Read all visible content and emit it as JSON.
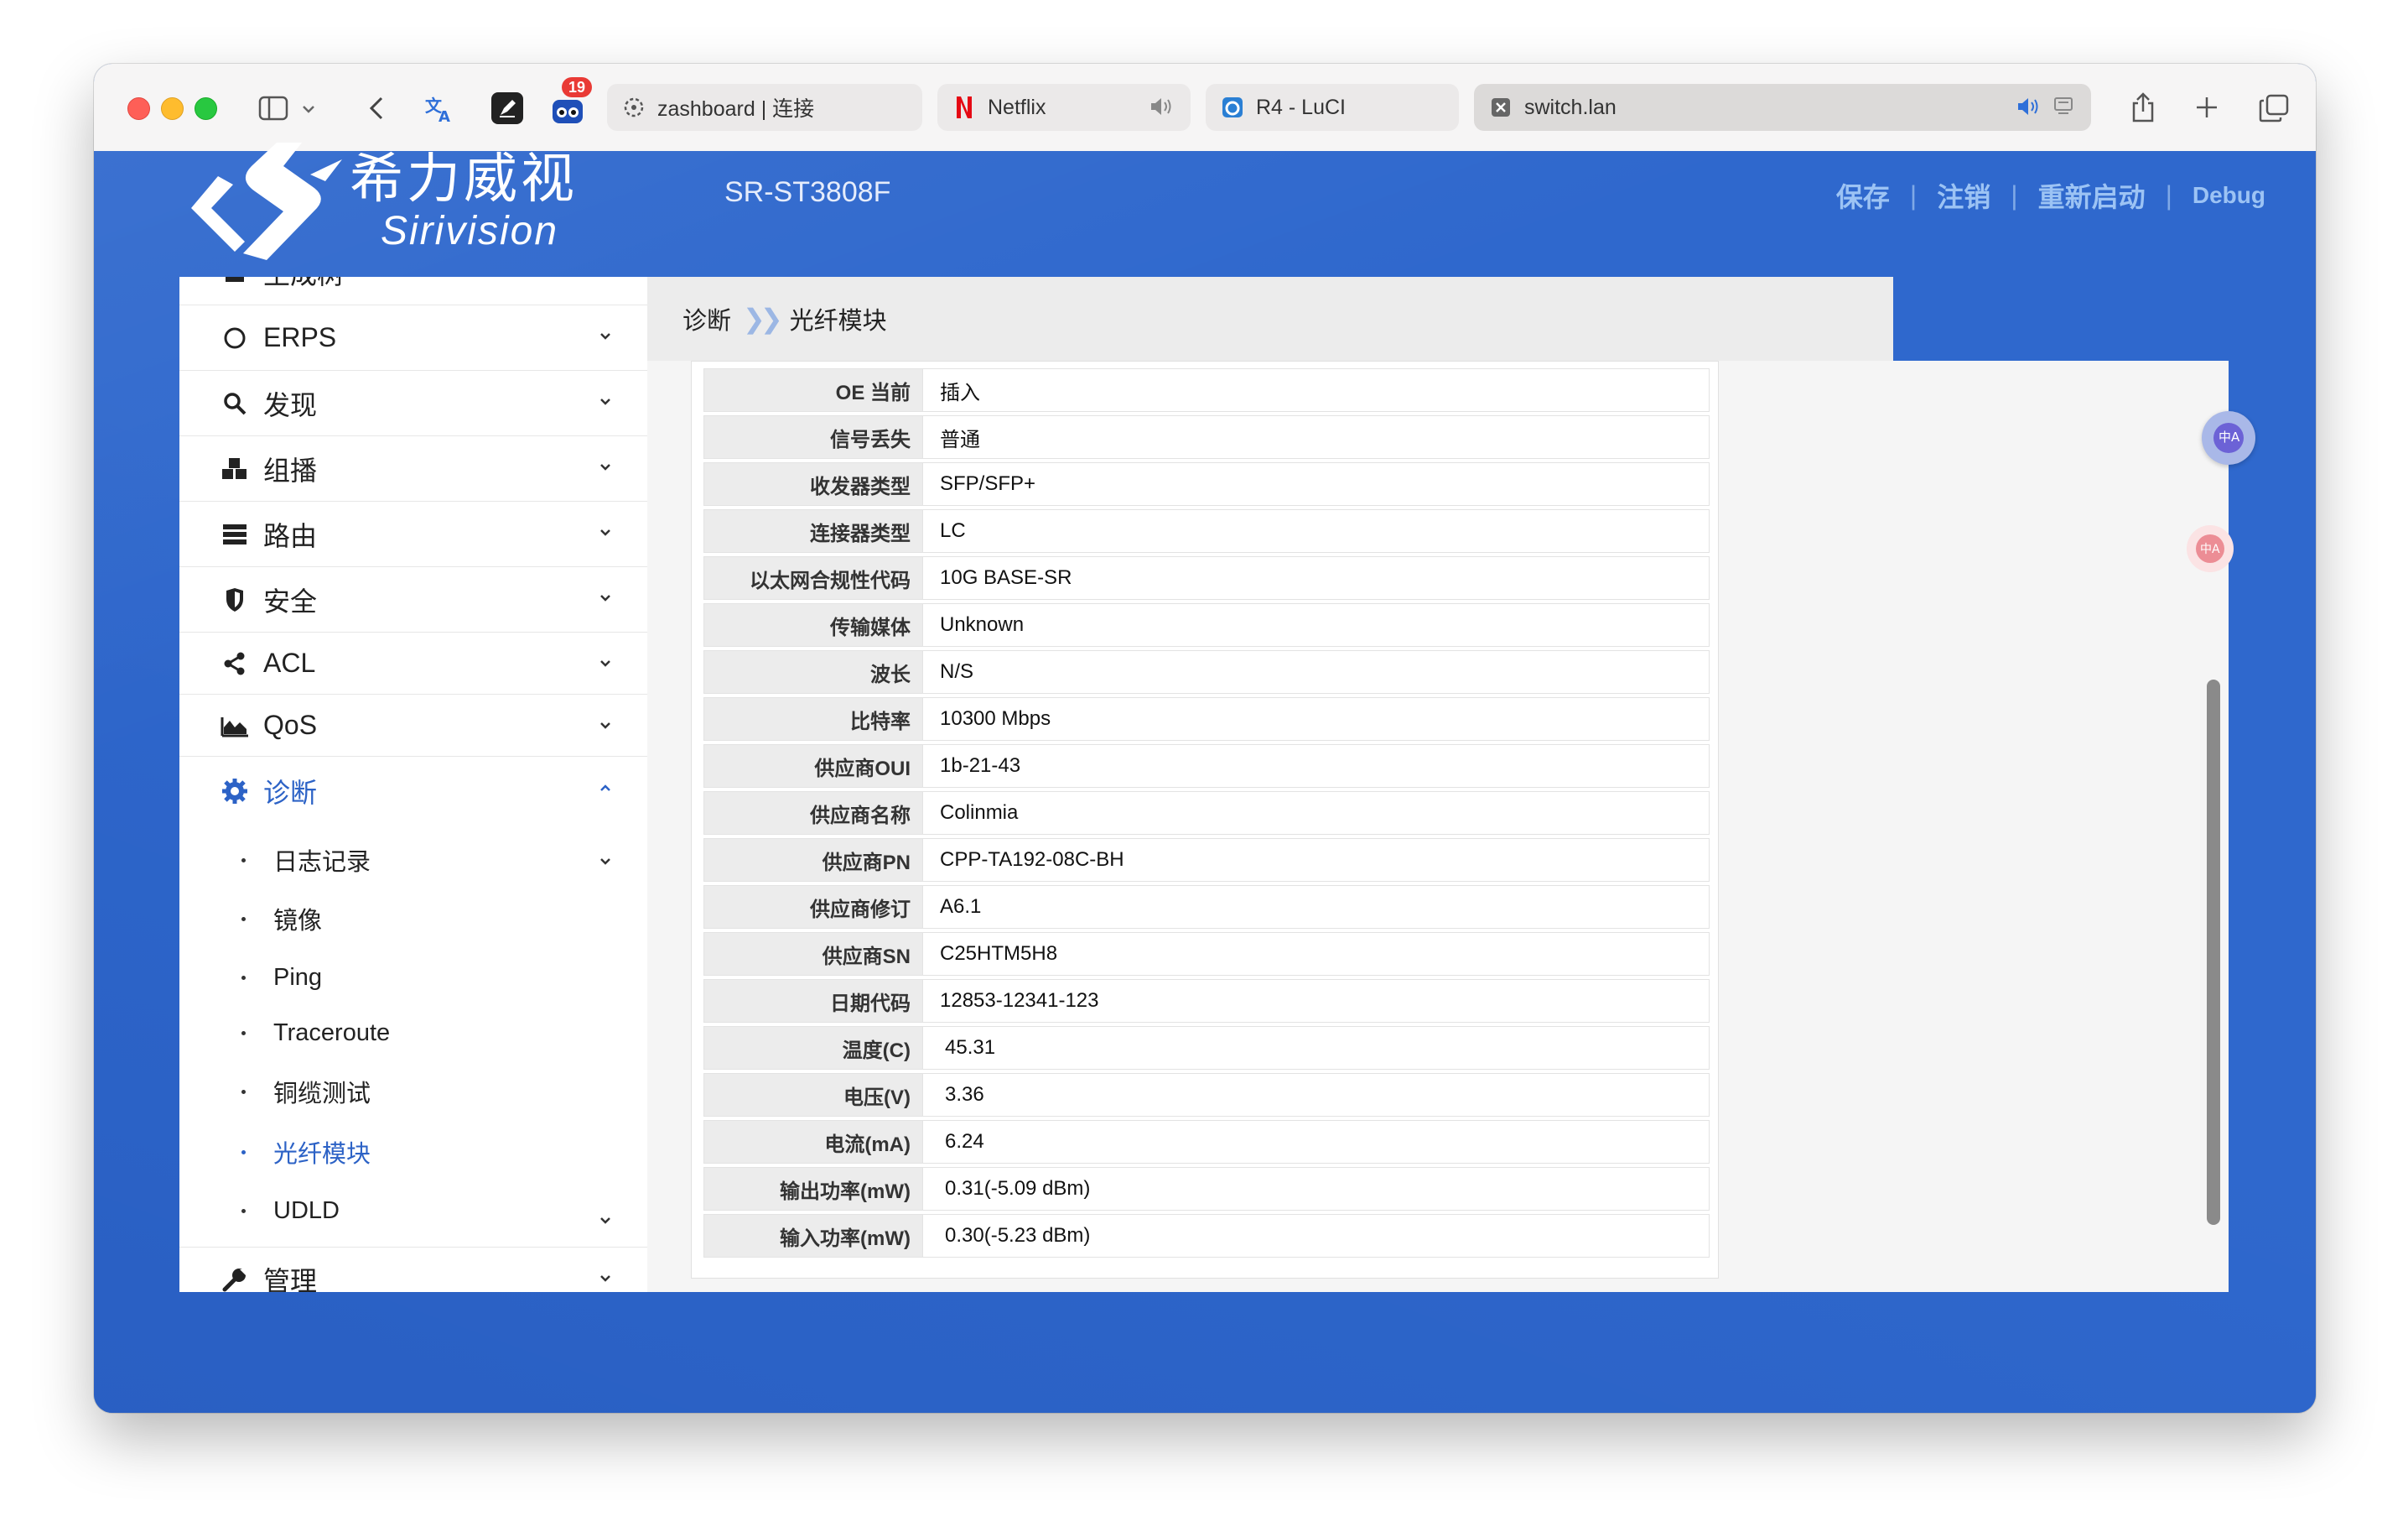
{
  "browser": {
    "tabs": [
      {
        "label": "zashboard | 连接",
        "icon": "zashboard-icon",
        "active": false
      },
      {
        "label": "Netflix",
        "icon": "netflix-icon",
        "active": false
      },
      {
        "label": "R4 - LuCI",
        "icon": "luci-icon",
        "active": false
      },
      {
        "label": "switch.lan",
        "icon": "close-tab-icon",
        "active": true
      }
    ],
    "extension_badge": "19"
  },
  "header": {
    "logo_cn": "希力威视",
    "logo_en": "Sirivision",
    "model": "SR-ST3808F",
    "nav": {
      "save": "保存",
      "logout": "注销",
      "reboot": "重新启动",
      "debug": "Debug"
    }
  },
  "sidebar": {
    "partial_top_label": "生成树",
    "items": [
      {
        "label": "ERPS",
        "icon": "circle-icon"
      },
      {
        "label": "发现",
        "icon": "search-icon"
      },
      {
        "label": "组播",
        "icon": "cubes-icon"
      },
      {
        "label": "路由",
        "icon": "server-icon"
      },
      {
        "label": "安全",
        "icon": "shield-icon"
      },
      {
        "label": "ACL",
        "icon": "share-icon"
      },
      {
        "label": "QoS",
        "icon": "area-chart-icon"
      },
      {
        "label": "诊断",
        "icon": "gear-icon"
      },
      {
        "label": "管理",
        "icon": "wrench-icon"
      }
    ],
    "sub_items": [
      {
        "label": "日志记录"
      },
      {
        "label": "镜像"
      },
      {
        "label": "Ping"
      },
      {
        "label": "Traceroute"
      },
      {
        "label": "铜缆测试"
      },
      {
        "label": "光纤模块"
      },
      {
        "label": "UDLD"
      }
    ]
  },
  "breadcrumb": {
    "parent": "诊断",
    "current": "光纤模块"
  },
  "module_info": [
    {
      "key": "OE 当前",
      "value": "插入"
    },
    {
      "key": "信号丢失",
      "value": "普通"
    },
    {
      "key": "收发器类型",
      "value": "SFP/SFP+"
    },
    {
      "key": "连接器类型",
      "value": "LC"
    },
    {
      "key": "以太网合规性代码",
      "value": "10G BASE-SR"
    },
    {
      "key": "传输媒体",
      "value": "Unknown"
    },
    {
      "key": "波长",
      "value": "N/S"
    },
    {
      "key": "比特率",
      "value": "10300 Mbps"
    },
    {
      "key": "供应商OUI",
      "value": "1b-21-43"
    },
    {
      "key": "供应商名称",
      "value": "Colinmia"
    },
    {
      "key": "供应商PN",
      "value": "CPP-TA192-08C-BH"
    },
    {
      "key": "供应商修订",
      "value": "A6.1"
    },
    {
      "key": "供应商SN",
      "value": "C25HTM5H8"
    },
    {
      "key": "日期代码",
      "value": "12853-12341-123"
    },
    {
      "key": "温度(C)",
      "value": "45.31"
    },
    {
      "key": "电压(V)",
      "value": "3.36"
    },
    {
      "key": "电流(mA)",
      "value": "6.24"
    },
    {
      "key": "输出功率(mW)",
      "value": "0.31(-5.09 dBm)"
    },
    {
      "key": "输入功率(mW)",
      "value": "0.30(-5.23 dBm)"
    }
  ],
  "colors": {
    "brand_blue": "#2f68cd",
    "active_link": "#2c62c6",
    "nav_text": "#9cc3f4"
  }
}
